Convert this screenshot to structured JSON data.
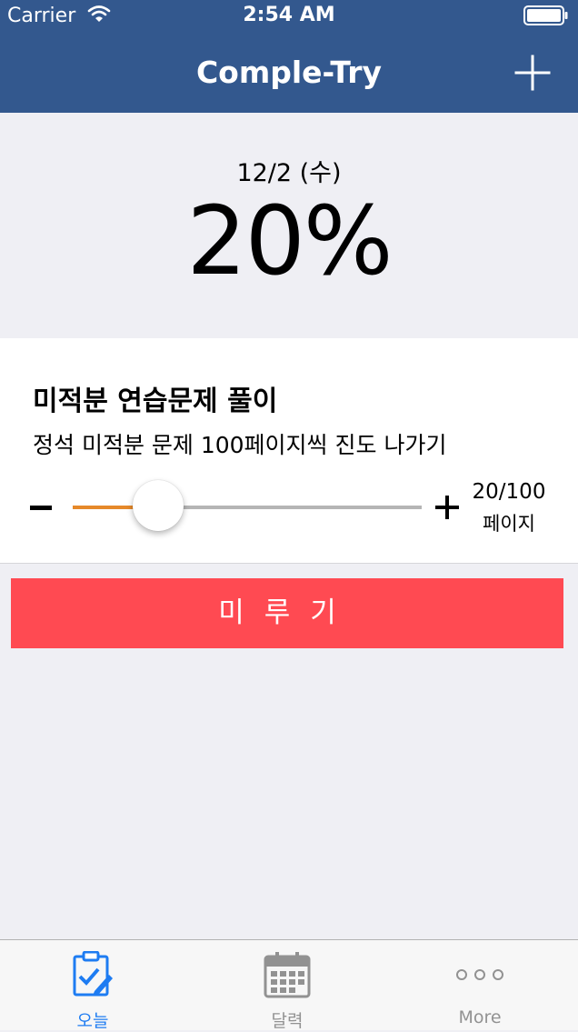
{
  "status_bar": {
    "carrier": "Carrier",
    "time": "2:54 AM"
  },
  "nav": {
    "title": "Comple-Try",
    "add_icon": "plus-icon"
  },
  "summary": {
    "date": "12/2 (수)",
    "percent": "20%"
  },
  "task": {
    "title": "미적분 연습문제 풀이",
    "description": "정석 미적분 문제 100페이지씩 진도 나가기",
    "progress_fraction": 0.2,
    "progress_count": "20/100",
    "progress_unit": "페이지"
  },
  "postpone_button": {
    "label": "미루기"
  },
  "tabs": [
    {
      "label": "오늘",
      "icon": "clipboard-check-icon",
      "selected": true
    },
    {
      "label": "달력",
      "icon": "calendar-icon",
      "selected": false
    },
    {
      "label": "More",
      "icon": "more-dots-icon",
      "selected": false
    }
  ],
  "colors": {
    "nav_background": "#33588e",
    "slider_fill": "#e6892a",
    "postpone_button": "#ff4a52",
    "tab_selected": "#1e7cf2",
    "tab_unselected": "#929292"
  }
}
